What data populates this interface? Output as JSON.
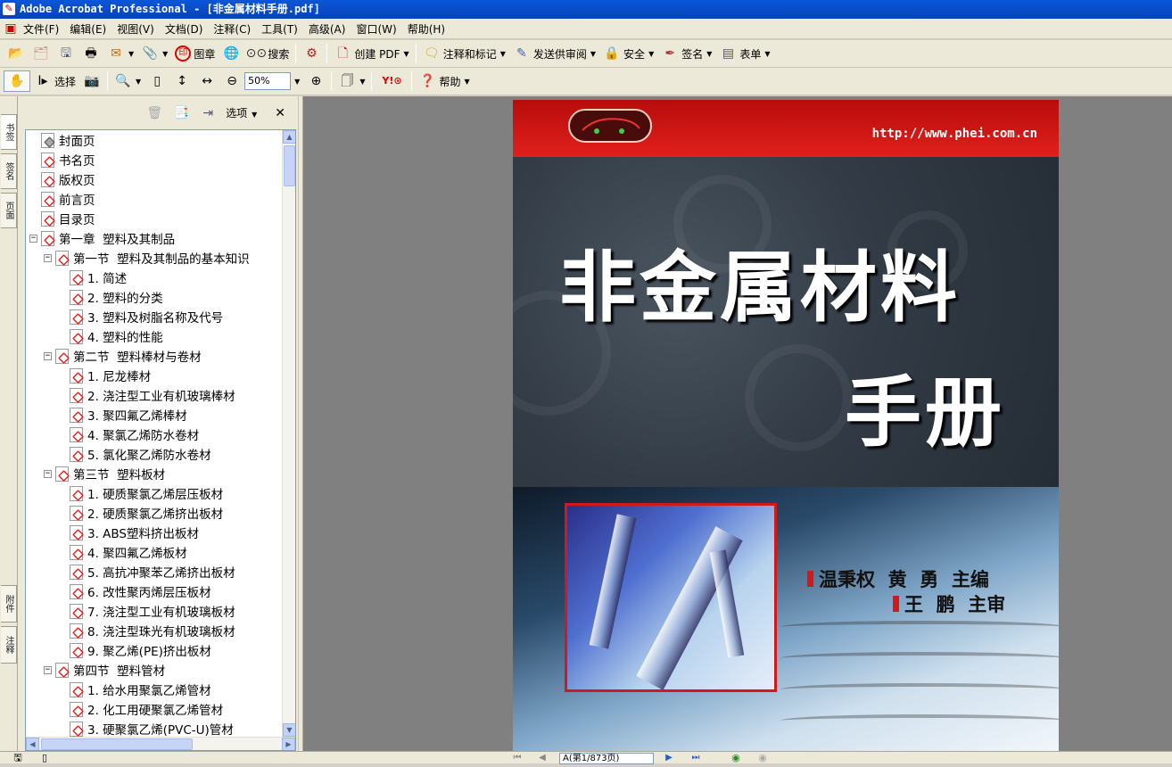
{
  "window": {
    "title": "Adobe Acrobat Professional - [非金属材料手册.pdf]"
  },
  "menu": [
    "文件(F)",
    "编辑(E)",
    "视图(V)",
    "文档(D)",
    "注释(C)",
    "工具(T)",
    "高级(A)",
    "窗口(W)",
    "帮助(H)"
  ],
  "toolbar1": {
    "stamp_label": "图章",
    "search_label": "搜索",
    "create_pdf_label": "创建 PDF",
    "comment_label": "注释和标记",
    "review_label": "发送供审阅",
    "security_label": "安全",
    "sign_label": "签名",
    "forms_label": "表单"
  },
  "toolbar2": {
    "select_label": "选择",
    "zoom_value": "50%",
    "help_label": "帮助"
  },
  "side_tabs": [
    "书签",
    "签名",
    "页面",
    "附件",
    "注释"
  ],
  "nav": {
    "options_label": "选项",
    "bookmarks": [
      {
        "label": "封面页",
        "level": 0
      },
      {
        "label": "书名页",
        "level": 0
      },
      {
        "label": "版权页",
        "level": 0
      },
      {
        "label": "前言页",
        "level": 0
      },
      {
        "label": "目录页",
        "level": 0
      },
      {
        "label": "第一章  塑料及其制品",
        "level": 0,
        "expanded": true
      },
      {
        "label": "第一节  塑料及其制品的基本知识",
        "level": 1,
        "expanded": true
      },
      {
        "label": "1. 简述",
        "level": 2
      },
      {
        "label": "2. 塑料的分类",
        "level": 2
      },
      {
        "label": "3. 塑料及树脂名称及代号",
        "level": 2
      },
      {
        "label": "4. 塑料的性能",
        "level": 2
      },
      {
        "label": "第二节  塑料棒材与卷材",
        "level": 1,
        "expanded": true
      },
      {
        "label": "1. 尼龙棒材",
        "level": 2
      },
      {
        "label": "2. 浇注型工业有机玻璃棒材",
        "level": 2
      },
      {
        "label": "3. 聚四氟乙烯棒材",
        "level": 2
      },
      {
        "label": "4. 聚氯乙烯防水卷材",
        "level": 2
      },
      {
        "label": "5. 氯化聚乙烯防水卷材",
        "level": 2
      },
      {
        "label": "第三节  塑料板材",
        "level": 1,
        "expanded": true
      },
      {
        "label": "1. 硬质聚氯乙烯层压板材",
        "level": 2
      },
      {
        "label": "2. 硬质聚氯乙烯挤出板材",
        "level": 2
      },
      {
        "label": "3. ABS塑料挤出板材",
        "level": 2
      },
      {
        "label": "4. 聚四氟乙烯板材",
        "level": 2
      },
      {
        "label": "5. 高抗冲聚苯乙烯挤出板材",
        "level": 2
      },
      {
        "label": "6. 改性聚丙烯层压板材",
        "level": 2
      },
      {
        "label": "7. 浇注型工业有机玻璃板材",
        "level": 2
      },
      {
        "label": "8. 浇注型珠光有机玻璃板材",
        "level": 2
      },
      {
        "label": "9. 聚乙烯(PE)挤出板材",
        "level": 2
      },
      {
        "label": "第四节  塑料管材",
        "level": 1,
        "expanded": true
      },
      {
        "label": "1. 给水用聚氯乙烯管材",
        "level": 2
      },
      {
        "label": "2. 化工用硬聚氯乙烯管材",
        "level": 2
      },
      {
        "label": "3. 硬聚氯乙烯(PVC-U)管材",
        "level": 2
      }
    ]
  },
  "cover": {
    "url": "http://www.phei.com.cn",
    "title_line1": "非金属材料",
    "title_line2": "手册",
    "authors": "温秉权  黄  勇  主编",
    "reviewer": "王  鹏  主审"
  },
  "status": {
    "page_indicator": "A(第1/873页)"
  }
}
